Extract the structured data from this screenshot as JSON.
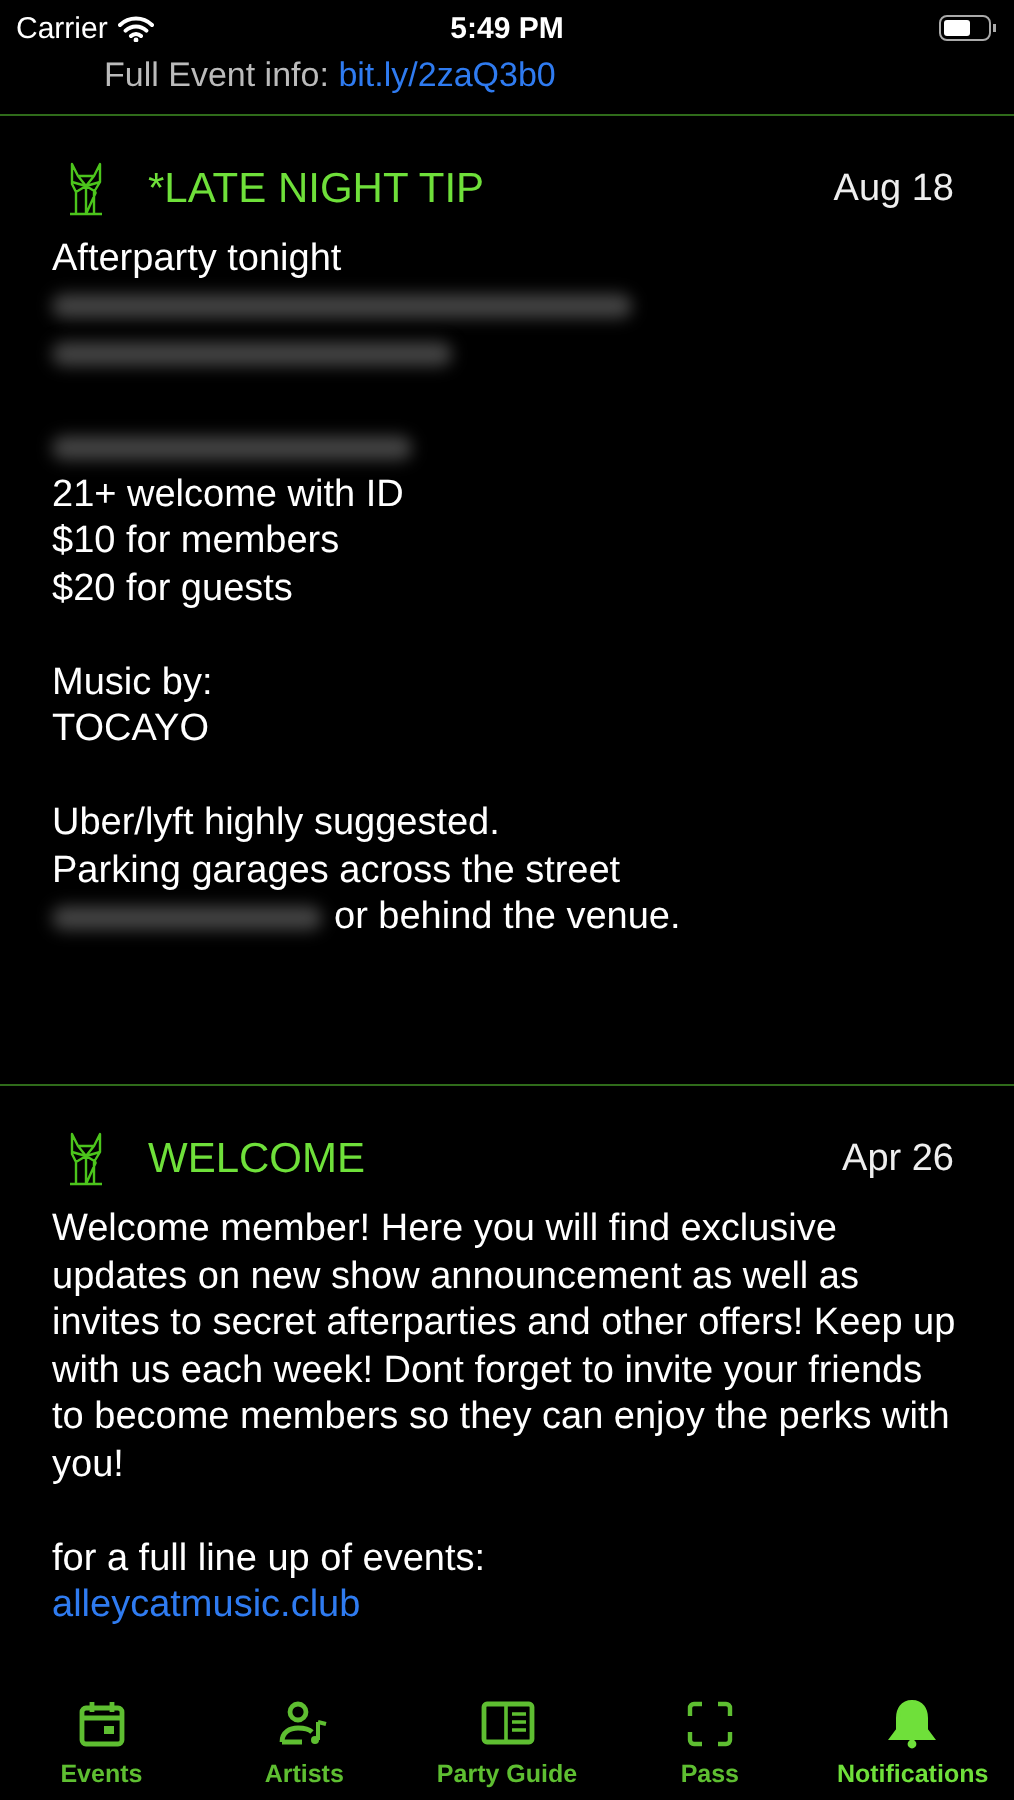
{
  "status_bar": {
    "carrier": "Carrier",
    "time": "5:49 PM"
  },
  "top_cut": {
    "text": "Full Event info:",
    "link": "bit.ly/2zaQ3b0"
  },
  "posts": [
    {
      "title": "*LATE NIGHT TIP",
      "date": "Aug 18",
      "lines": [
        {
          "kind": "text",
          "text": "Afterparty tonight"
        },
        {
          "kind": "blurred"
        },
        {
          "kind": "blurred"
        },
        {
          "kind": "gap"
        },
        {
          "kind": "blurred"
        },
        {
          "kind": "text",
          "text": "21+ welcome with ID"
        },
        {
          "kind": "text",
          "text": "$10 for members"
        },
        {
          "kind": "text",
          "text": "$20 for guests"
        },
        {
          "kind": "gap"
        },
        {
          "kind": "text",
          "text": "Music by:"
        },
        {
          "kind": "text",
          "text": "TOCAYO"
        },
        {
          "kind": "gap"
        },
        {
          "kind": "text",
          "text": "Uber/lyft highly suggested."
        },
        {
          "kind": "text",
          "text": "Parking garages across the street"
        },
        {
          "kind": "blurred_prefix",
          "text": "or behind the venue."
        }
      ]
    },
    {
      "title": "WELCOME",
      "date": "Apr 26",
      "lines": [
        {
          "kind": "text",
          "text": "Welcome member! Here you will find exclusive updates on new show announcement as well as invites to secret afterparties and other offers! Keep up with us each week! Dont forget to invite your friends to become members so they can enjoy the perks with you!"
        },
        {
          "kind": "gap"
        },
        {
          "kind": "text",
          "text": "for a full line up of events:"
        },
        {
          "kind": "link",
          "text": "alleycatmusic.club"
        }
      ]
    }
  ],
  "tabs": [
    {
      "label": "Events",
      "selected": false
    },
    {
      "label": "Artists",
      "selected": false
    },
    {
      "label": "Party Guide",
      "selected": false
    },
    {
      "label": "Pass",
      "selected": false
    },
    {
      "label": "Notifications",
      "selected": true
    }
  ]
}
